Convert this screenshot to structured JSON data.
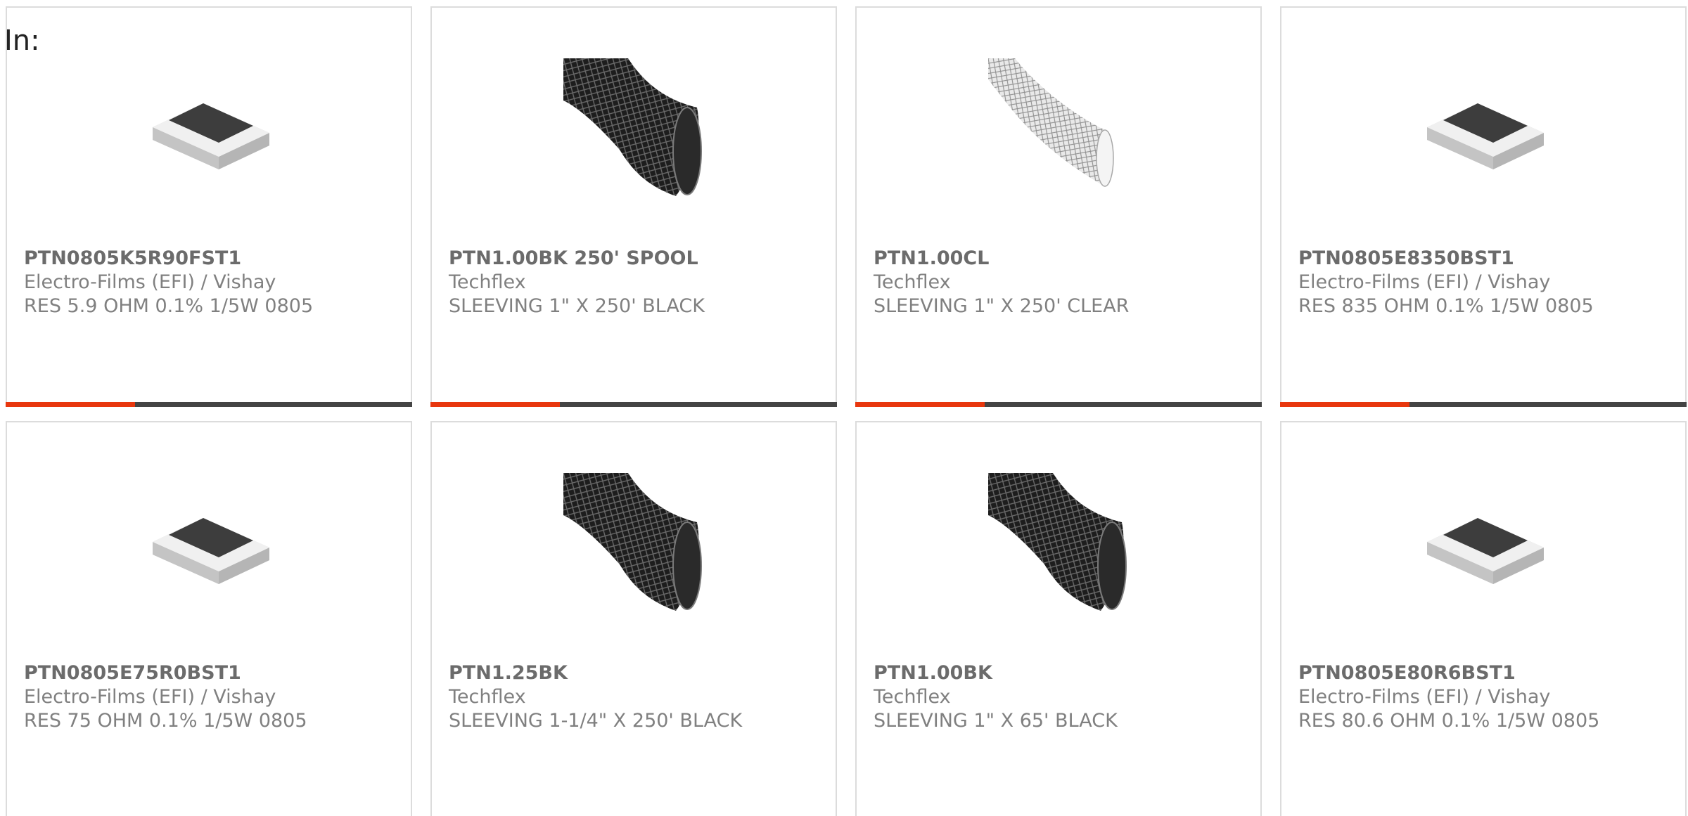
{
  "header": {
    "in_label": "In:"
  },
  "colors": {
    "accent": "#e8370e",
    "bar": "#444444",
    "border": "#dcdcdc"
  },
  "products": [
    {
      "part": "PTN0805K5R90FST1",
      "maker": "Electro-Films (EFI) / Vishay",
      "desc": "RES 5.9 OHM 0.1% 1/5W 0805",
      "image": "chip-resistor-image"
    },
    {
      "part": "PTN1.00BK 250' SPOOL",
      "maker": "Techflex",
      "desc": "SLEEVING 1\" X 250' BLACK",
      "image": "black-sleeving-image"
    },
    {
      "part": "PTN1.00CL",
      "maker": "Techflex",
      "desc": "SLEEVING 1\" X 250' CLEAR",
      "image": "clear-sleeving-image"
    },
    {
      "part": "PTN0805E8350BST1",
      "maker": "Electro-Films (EFI) / Vishay",
      "desc": "RES 835 OHM 0.1% 1/5W 0805",
      "image": "chip-resistor-image"
    },
    {
      "part": "PTN0805E75R0BST1",
      "maker": "Electro-Films (EFI) / Vishay",
      "desc": "RES 75 OHM 0.1% 1/5W 0805",
      "image": "chip-resistor-image"
    },
    {
      "part": "PTN1.25BK",
      "maker": "Techflex",
      "desc": "SLEEVING 1-1/4\" X 250' BLACK",
      "image": "black-sleeving-image"
    },
    {
      "part": "PTN1.00BK",
      "maker": "Techflex",
      "desc": "SLEEVING 1\" X 65' BLACK",
      "image": "black-sleeving-image"
    },
    {
      "part": "PTN0805E80R6BST1",
      "maker": "Electro-Films (EFI) / Vishay",
      "desc": "RES 80.6 OHM 0.1% 1/5W 0805",
      "image": "chip-resistor-image"
    }
  ]
}
